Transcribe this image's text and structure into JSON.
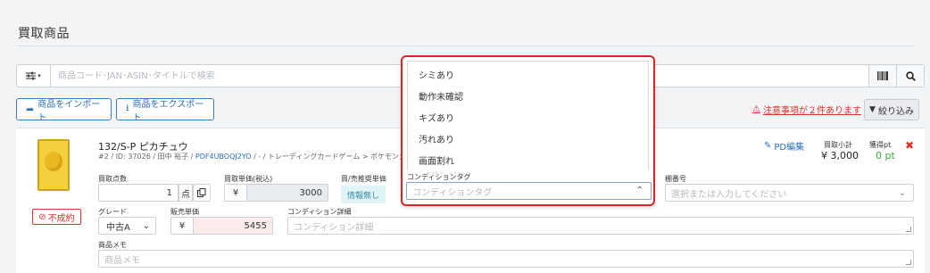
{
  "page": {
    "title": "買取商品"
  },
  "search": {
    "filter_icon": "sliders-icon",
    "placeholder": "商品コード･JAN･ASIN･タイトルで検索"
  },
  "actions": {
    "import_label": "商品をインポート",
    "export_label": "商品をエクスポート",
    "notice_label": "注意事項が２件あります",
    "filter_label": "絞り込み"
  },
  "item": {
    "name": "132/S-P ピカチュウ",
    "meta_prefix": "#2 / ID: 37026 / 田中 裕子 / ",
    "meta_link": "PDF4UBOQJ2YO",
    "meta_suffix": " / - / トレーディングカードゲーム > ポケモンカードゲーム",
    "status_label": "不成約",
    "pd_edit_label": "PD編集",
    "subtotal_label": "買取小計",
    "subtotal_value": "¥ 3,000",
    "points_label": "獲得pt",
    "points_value": "0 pt",
    "delete_glyph": "✖"
  },
  "fields": {
    "quantity_label": "買取点数",
    "quantity_value": "1",
    "quantity_unit": "点",
    "unit_price_label": "買取単価(税込)",
    "yen": "¥",
    "unit_price_value": "3000",
    "recommend_label": "買/売推奨単価",
    "recommend_value": "情報無し",
    "condition_tag_label": "コンディションタグ",
    "condition_tag_placeholder": "コンディションタグ",
    "shelf_label": "棚番号",
    "shelf_placeholder": "選択または入力してください",
    "grade_label": "グレード",
    "grade_value": "中古A",
    "sale_price_label": "販売単価",
    "sale_price_value": "5455",
    "condition_detail_label": "コンディション詳細",
    "condition_detail_placeholder": "コンディション詳細",
    "memo_label": "商品メモ",
    "memo_placeholder": "商品メモ"
  },
  "dropdown": {
    "options": [
      "シミあり",
      "動作未確認",
      "キズあり",
      "汚れあり",
      "画面割れ"
    ]
  },
  "colors": {
    "accent": "#2c6fb6",
    "danger": "#d9352b",
    "highlight_border": "#e02424"
  }
}
